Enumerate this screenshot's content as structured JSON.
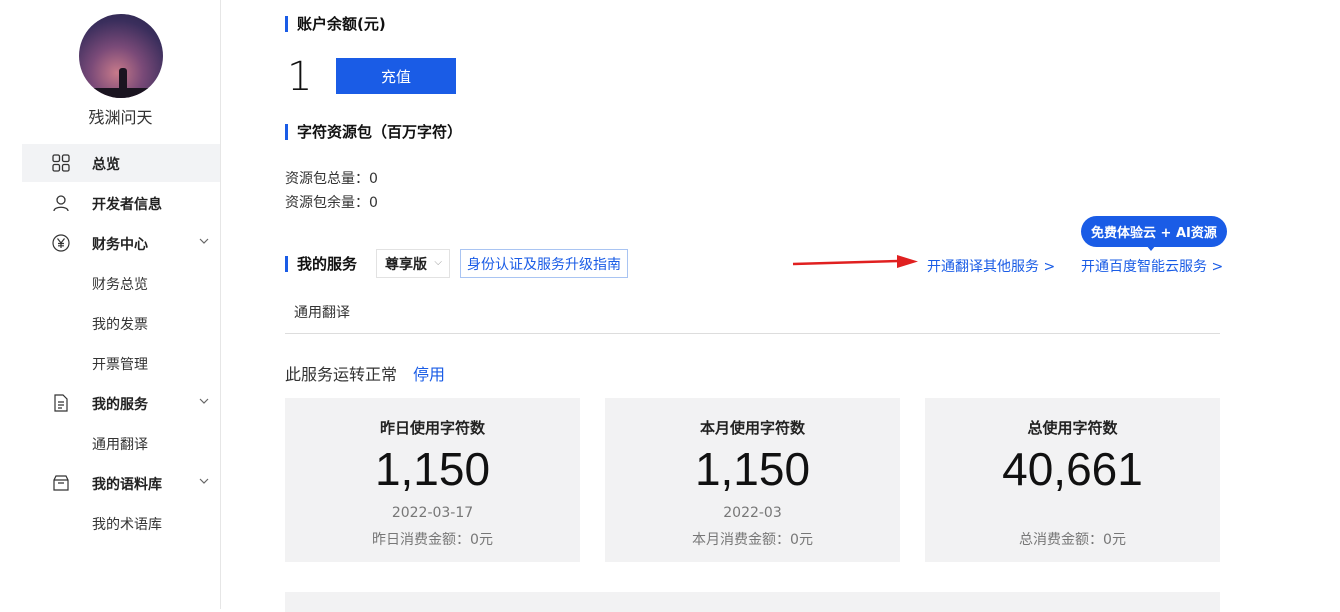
{
  "user": {
    "name": "残渊问天"
  },
  "sidebar": {
    "items": [
      {
        "label": "总览",
        "icon": "grid-icon"
      },
      {
        "label": "开发者信息",
        "icon": "user-icon"
      },
      {
        "label": "财务中心",
        "icon": "yen-icon"
      },
      {
        "label": "财务总览"
      },
      {
        "label": "我的发票"
      },
      {
        "label": "开票管理"
      },
      {
        "label": "我的服务",
        "icon": "document-icon"
      },
      {
        "label": "通用翻译"
      },
      {
        "label": "我的语料库",
        "icon": "box-icon"
      },
      {
        "label": "我的术语库"
      }
    ]
  },
  "balance": {
    "title": "账户余额(元)",
    "value": "1",
    "recharge_label": "充值"
  },
  "resource": {
    "title": "字符资源包（百万字符）",
    "total": "资源包总量：0",
    "remaining": "资源包余量：0"
  },
  "services": {
    "title": "我的服务",
    "edition": "尊享版",
    "guide_label": "身份认证及服务升级指南",
    "open_other": "开通翻译其他服务 >",
    "open_cloud": "开通百度智能云服务 >",
    "badge": "免费体验云 + AI资源",
    "tab": "通用翻译",
    "status": "此服务运转正常",
    "stop_label": "停用"
  },
  "stats": [
    {
      "title": "昨日使用字符数",
      "value": "1,150",
      "date": "2022-03-17",
      "fee": "昨日消费金额：0元"
    },
    {
      "title": "本月使用字符数",
      "value": "1,150",
      "date": "2022-03",
      "fee": "本月消费金额：0元"
    },
    {
      "title": "总使用字符数",
      "value": "40,661",
      "date": "",
      "fee": "总消费金额：0元"
    }
  ],
  "colors": {
    "accent": "#1a5ce6",
    "arrow": "#e02020"
  }
}
